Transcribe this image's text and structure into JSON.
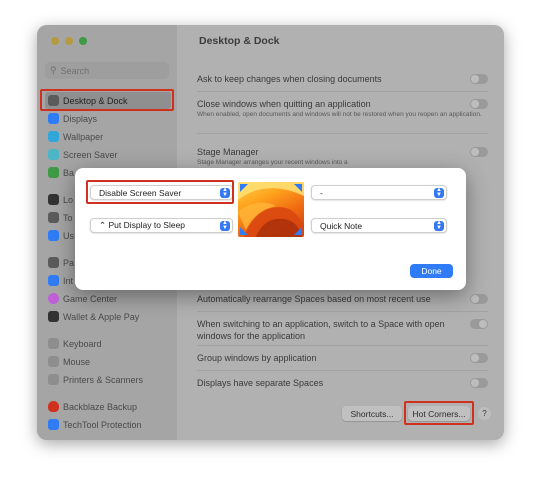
{
  "window": {
    "title": "Desktop & Dock",
    "search_placeholder": "Search"
  },
  "sidebar": {
    "items": [
      {
        "label": "Desktop & Dock",
        "color": "#5b5b5b"
      },
      {
        "label": "Displays",
        "color": "#2f7cf6"
      },
      {
        "label": "Wallpaper",
        "color": "#31a7d9"
      },
      {
        "label": "Screen Saver",
        "color": "#4cb5c8"
      },
      {
        "label": "Ba",
        "color": "#3f9a45"
      },
      {
        "label": "Lo",
        "color": "#333333"
      },
      {
        "label": "To",
        "color": "#5b5b5b"
      },
      {
        "label": "Us",
        "color": "#2f7cf6"
      },
      {
        "label": "Pa",
        "color": "#5b5b5b"
      },
      {
        "label": "Int",
        "color": "#2f7cf6"
      },
      {
        "label": "Game Center",
        "color": "#c060d8"
      },
      {
        "label": "Wallet & Apple Pay",
        "color": "#333333"
      },
      {
        "label": "Keyboard",
        "color": "#8e8e8e"
      },
      {
        "label": "Mouse",
        "color": "#8e8e8e"
      },
      {
        "label": "Printers & Scanners",
        "color": "#8e8e8e"
      },
      {
        "label": "Backblaze Backup",
        "color": "#d0311e"
      },
      {
        "label": "TechTool Protection",
        "color": "#2f7cf6"
      }
    ]
  },
  "content": {
    "rows": [
      {
        "label": "Ask to keep changes when closing documents",
        "sub": "",
        "toggle": false
      },
      {
        "label": "Close windows when quitting an application",
        "sub": "When enabled, open documents and windows will not be restored when you reopen an application.",
        "toggle": false
      },
      {
        "label": "Stage Manager",
        "sub": "Stage Manager arranges your recent windows into a",
        "toggle": false
      },
      {
        "label": "Automatically rearrange Spaces based on most recent use",
        "sub": "",
        "toggle": false
      },
      {
        "label": "When switching to an application, switch to a Space with open windows for the application",
        "sub": "",
        "toggle": true
      },
      {
        "label": "Group windows by application",
        "sub": "",
        "toggle": false
      },
      {
        "label": "Displays have separate Spaces",
        "sub": "",
        "toggle": false
      }
    ],
    "shortcuts_label": "Shortcuts...",
    "hot_corners_label": "Hot Corners...",
    "help_label": "?"
  },
  "hot_corners_dialog": {
    "top_left": "Disable Screen Saver",
    "top_right": "-",
    "bottom_left": "⌃ Put Display to Sleep",
    "bottom_right": "Quick Note",
    "done_label": "Done"
  },
  "colors": {
    "accent": "#2f7cf6",
    "highlight": "#d0311e"
  }
}
